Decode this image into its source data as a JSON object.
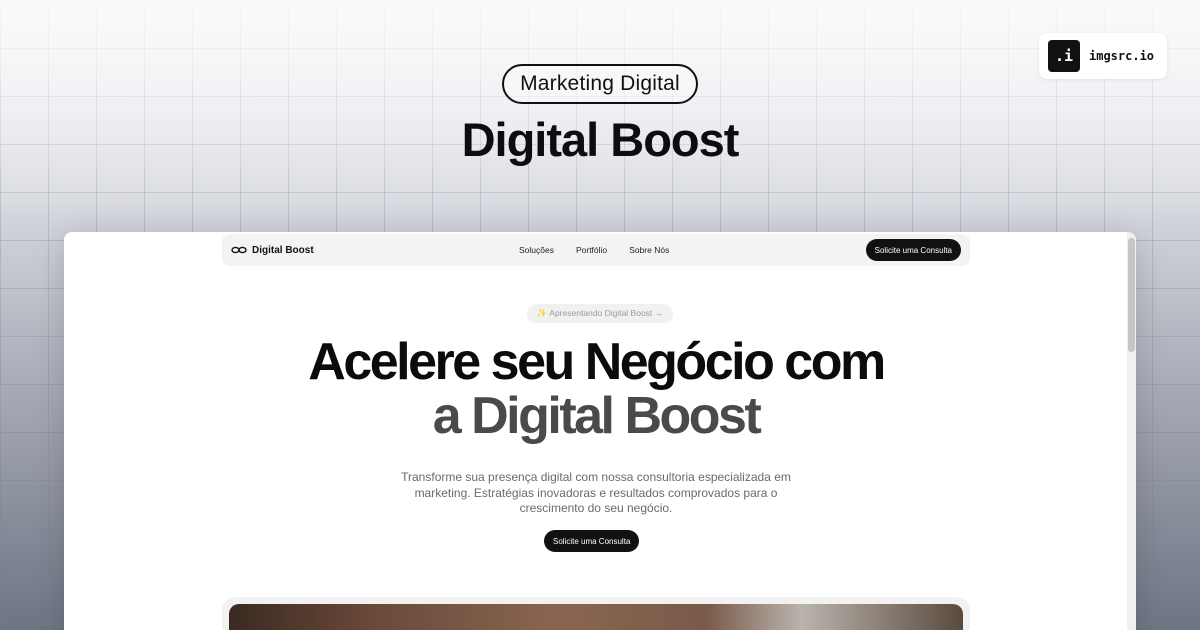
{
  "badge": "Marketing Digital",
  "hero_title": "Digital Boost",
  "logo": {
    "mark": ".i",
    "text": "imgsrc.io"
  },
  "site": {
    "nav": {
      "brand": "Digital Boost",
      "links": [
        "Soluções",
        "Portfólio",
        "Sobre Nós"
      ],
      "cta": "Solicite uma Consulta"
    },
    "intro_pill": "✨ Apresentando Digital Boost →",
    "headline_line1": "Acelere seu Negócio com",
    "headline_line2": "a Digital Boost",
    "subtitle": "Transforme sua presença digital com nossa consultoria especializada em marketing. Estratégias inovadoras e resultados comprovados para o crescimento do seu negócio.",
    "hero_cta": "Solicite uma Consulta"
  },
  "colors": {
    "accent": "#111111",
    "text_muted": "#6a6a6a"
  },
  "icons": {
    "nav_logo": "infinity-links-icon"
  }
}
